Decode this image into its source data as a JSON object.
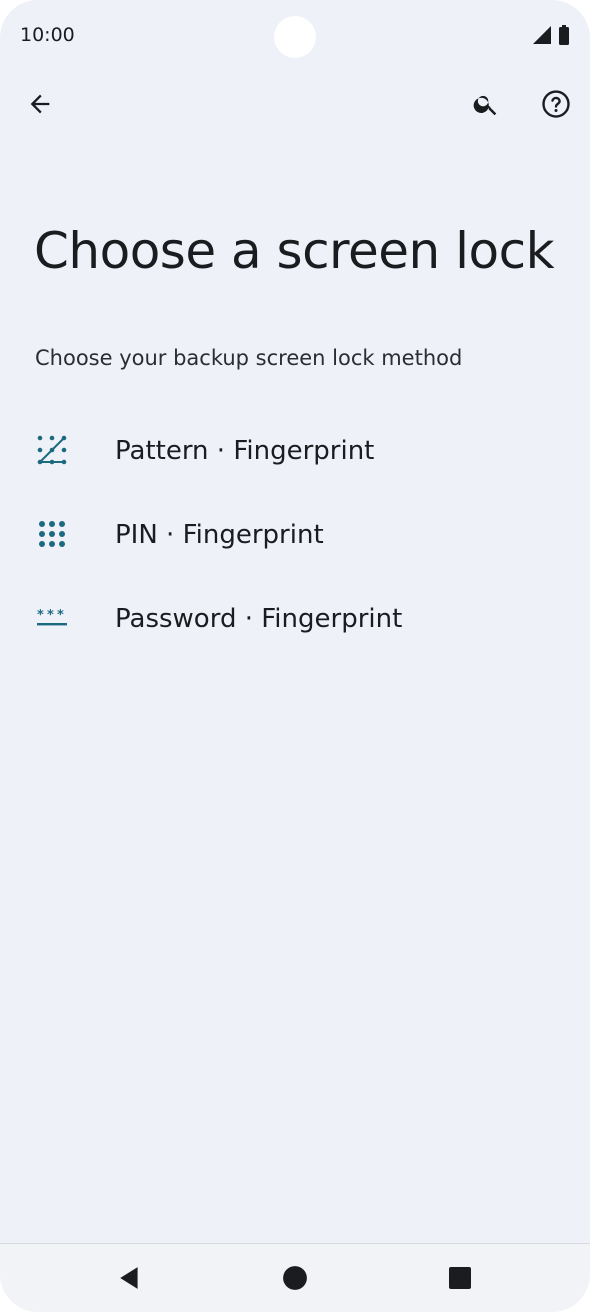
{
  "status_bar": {
    "time": "10:00",
    "icons": [
      "signal-icon",
      "battery-icon"
    ]
  },
  "top_bar": {
    "icons": [
      "back-arrow-icon",
      "search-icon",
      "help-icon"
    ]
  },
  "page": {
    "title": "Choose a screen lock",
    "subtitle": "Choose your backup screen lock method"
  },
  "options": [
    {
      "label": "Pattern · Fingerprint",
      "icon": "pattern-icon"
    },
    {
      "label": "PIN · Fingerprint",
      "icon": "pin-grid-icon"
    },
    {
      "label": "Password · Fingerprint",
      "icon": "password-icon"
    }
  ],
  "nav_bar": {
    "icons": [
      "nav-back-icon",
      "nav-home-icon",
      "nav-recents-icon"
    ]
  },
  "colors": {
    "background": "#eef1f8",
    "text": "#1b1c1f",
    "icon_accent": "#1c6a80"
  }
}
